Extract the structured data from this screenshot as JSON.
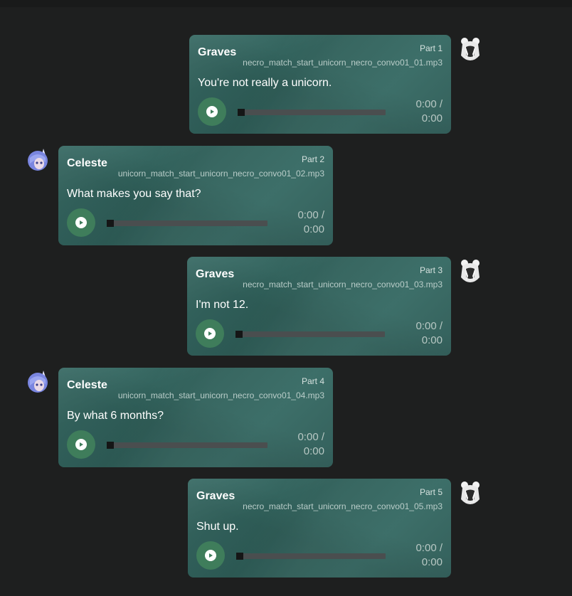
{
  "messages": [
    {
      "speaker": "Graves",
      "part": "Part 1",
      "file": "necro_match_start_unicorn_necro_convo01_01.mp3",
      "text": "You're not really a unicorn.",
      "time_current": "0:00 /",
      "time_total": "0:00"
    },
    {
      "speaker": "Celeste",
      "part": "Part 2",
      "file": "unicorn_match_start_unicorn_necro_convo01_02.mp3",
      "text": "What makes you say that?",
      "time_current": "0:00 /",
      "time_total": "0:00"
    },
    {
      "speaker": "Graves",
      "part": "Part 3",
      "file": "necro_match_start_unicorn_necro_convo01_03.mp3",
      "text": "I'm not 12.",
      "time_current": "0:00 /",
      "time_total": "0:00"
    },
    {
      "speaker": "Celeste",
      "part": "Part 4",
      "file": "unicorn_match_start_unicorn_necro_convo01_04.mp3",
      "text": "By what 6 months?",
      "time_current": "0:00 /",
      "time_total": "0:00"
    },
    {
      "speaker": "Graves",
      "part": "Part 5",
      "file": "necro_match_start_unicorn_necro_convo01_05.mp3",
      "text": "Shut up.",
      "time_current": "0:00 /",
      "time_total": "0:00"
    }
  ],
  "colors": {
    "background": "#1e1f1f",
    "bubble": "#32645e",
    "play_button": "#3f7d5b",
    "progress_track": "#4a4e4f"
  },
  "icons": {
    "play": "play-icon",
    "graves_avatar": "graves-avatar-icon",
    "celeste_avatar": "celeste-avatar-icon"
  }
}
